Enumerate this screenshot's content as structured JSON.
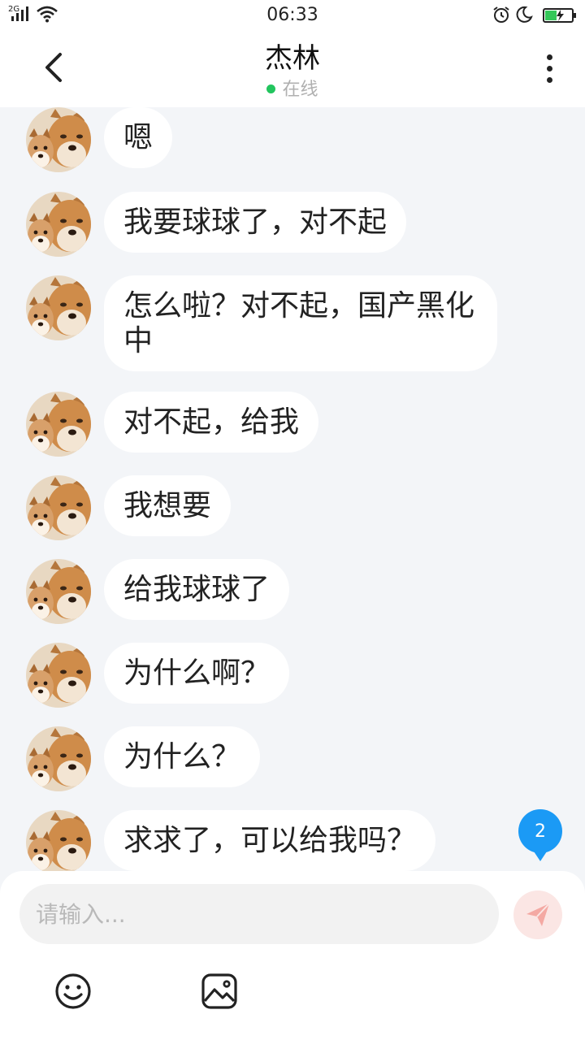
{
  "status_bar": {
    "network": "2G",
    "time": "06:33"
  },
  "header": {
    "title": "杰林",
    "status": "在线",
    "status_color": "#22c55e"
  },
  "messages": [
    {
      "text": "嗯"
    },
    {
      "text": "我要球球了，对不起"
    },
    {
      "text": "怎么啦？对不起，国产黑化中"
    },
    {
      "text": "对不起，给我"
    },
    {
      "text": "我想要"
    },
    {
      "text": "给我球球了"
    },
    {
      "text": "为什么啊？"
    },
    {
      "text": "为什么？"
    },
    {
      "text": "求求了，可以给我吗？"
    }
  ],
  "unread_count": "2",
  "composer": {
    "placeholder": "请输入...",
    "send_icon": "paper-plane-icon",
    "emoji_icon": "smiley-icon",
    "image_icon": "image-icon"
  },
  "colors": {
    "accent": "#1b9af5",
    "chat_background": "#f3f5f8",
    "send_button_bg": "#fbe6e4"
  }
}
